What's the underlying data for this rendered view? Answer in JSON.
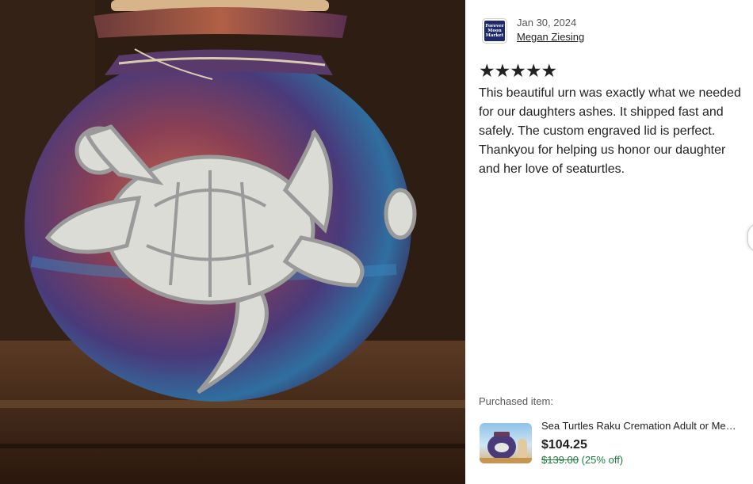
{
  "photo": {
    "subject": "sea turtle raku urn"
  },
  "review": {
    "date": "Jan 30, 2024",
    "reviewer_name": "Megan Ziesing",
    "avatar_text": "Forever Moon Market",
    "rating": 5,
    "rating_max": 5,
    "stars_text": "★★★★★",
    "text": "This beautiful urn was exactly what we needed for our daughters ashes. It shipped fast and safely. The custom engraved lid is perfect. Thankyou for helping us honor our daughter and her love of seaturtles."
  },
  "purchase": {
    "label": "Purchased item:",
    "title": "Sea Turtles Raku Cremation Adult or Me…",
    "price": "$104.25",
    "original_price": "$139.00",
    "discount": "(25% off)"
  },
  "icons": {
    "star": "star-icon",
    "next": "chevron-right-icon"
  },
  "colors": {
    "discount_green": "#1e7a3c",
    "text": "#222222",
    "muted": "#595959"
  }
}
